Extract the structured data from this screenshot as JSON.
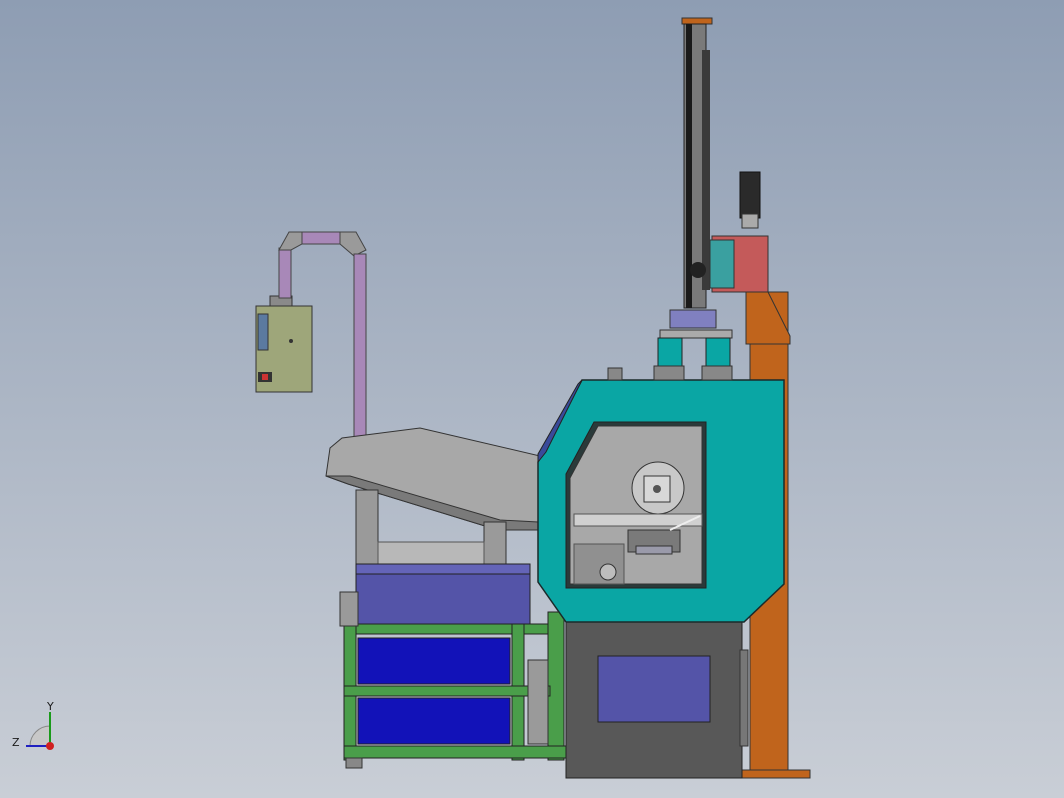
{
  "viewport": {
    "background_top": "#8e9db3",
    "background_bottom": "#c9ced6"
  },
  "colors": {
    "machine_teal": "#0aa6a4",
    "frame_green": "#4a9e4a",
    "bin_blue": "#1212b8",
    "tray_blue": "#5454a8",
    "column_orange": "#c0641c",
    "duct_pink": "#a888b8",
    "cabinet_olive": "#9ea67a",
    "base_gray": "#585858",
    "gear_red": "#c45a5a"
  },
  "triad": {
    "x_label": "",
    "y_label": "Y",
    "z_label": "Z"
  }
}
